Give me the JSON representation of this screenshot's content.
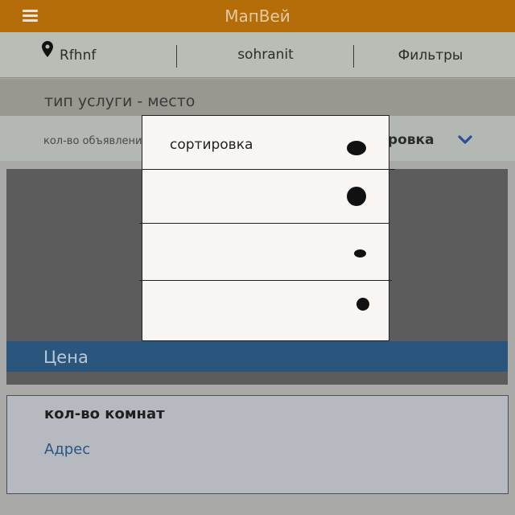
{
  "header": {
    "title": "МапВей",
    "menu_icon": "hamburger-menu-icon"
  },
  "actions": {
    "location_icon": "map-pin-icon",
    "location_label": "Rfhnf",
    "saved_label": "sohranit",
    "filters_label": "Фильтры"
  },
  "service_row": {
    "text": "тип услуги - место"
  },
  "sort_row": {
    "count_text": "кол-во объявлени",
    "sort_label_visible": "ировка",
    "chevron_icon": "chevron-down-icon"
  },
  "price_bar": {
    "label": "Цена"
  },
  "info_card": {
    "rooms_label": "кол-во комнат",
    "address_label": "Адрес"
  },
  "sort_dropdown": {
    "options": [
      {
        "label": "сортировка",
        "radio_icon": "radio-dot-icon"
      },
      {
        "label": "",
        "radio_icon": "radio-dot-icon"
      },
      {
        "label": "",
        "radio_icon": "radio-dot-icon"
      },
      {
        "label": "",
        "radio_icon": "radio-dot-icon"
      }
    ]
  },
  "colors": {
    "topbar": "#b46d08",
    "price_bar": "#2a557d",
    "dark_panel": "#5c5c5c",
    "dropdown_bg": "#f8f5f3"
  }
}
